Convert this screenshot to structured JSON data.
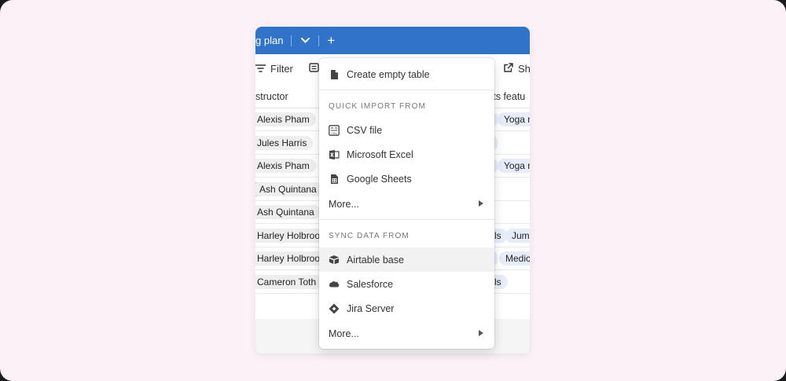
{
  "topbar": {
    "table_name": "g plan",
    "add": "+"
  },
  "toolbar": {
    "filter": "Filter",
    "share": "Sha"
  },
  "grid": {
    "headers": {
      "instructor": "structor",
      "products": "cts featu"
    },
    "rows": [
      {
        "instructor": "Alexis Pham",
        "right": [
          "",
          "Yoga m"
        ]
      },
      {
        "instructor": "Jules Harris",
        "right": [
          ""
        ]
      },
      {
        "instructor": "Alexis Pham",
        "right": [
          "",
          "Yoga m"
        ]
      },
      {
        "instructor": "Ash Quintana",
        "right": []
      },
      {
        "instructor": "Ash Quintana",
        "right": []
      },
      {
        "instructor": "Harley Holbrook",
        "right": [
          "ls",
          "Jump"
        ]
      },
      {
        "instructor": "Harley Holbrook",
        "right": [
          "",
          "Medic"
        ]
      },
      {
        "instructor": "Cameron Toth",
        "right": [
          "ls"
        ]
      }
    ]
  },
  "menu": {
    "create_empty": "Create empty table",
    "quick_import_heading": "QUICK IMPORT FROM",
    "csv": "CSV file",
    "excel": "Microsoft Excel",
    "sheets": "Google Sheets",
    "more1": "More...",
    "sync_heading": "SYNC DATA FROM",
    "airtable": "Airtable base",
    "salesforce": "Salesforce",
    "jira": "Jira Server",
    "more2": "More..."
  },
  "colors": {
    "topbar": "#3074c9",
    "background": "#fbf1f7",
    "accent_blue": "#2d7ff9"
  }
}
